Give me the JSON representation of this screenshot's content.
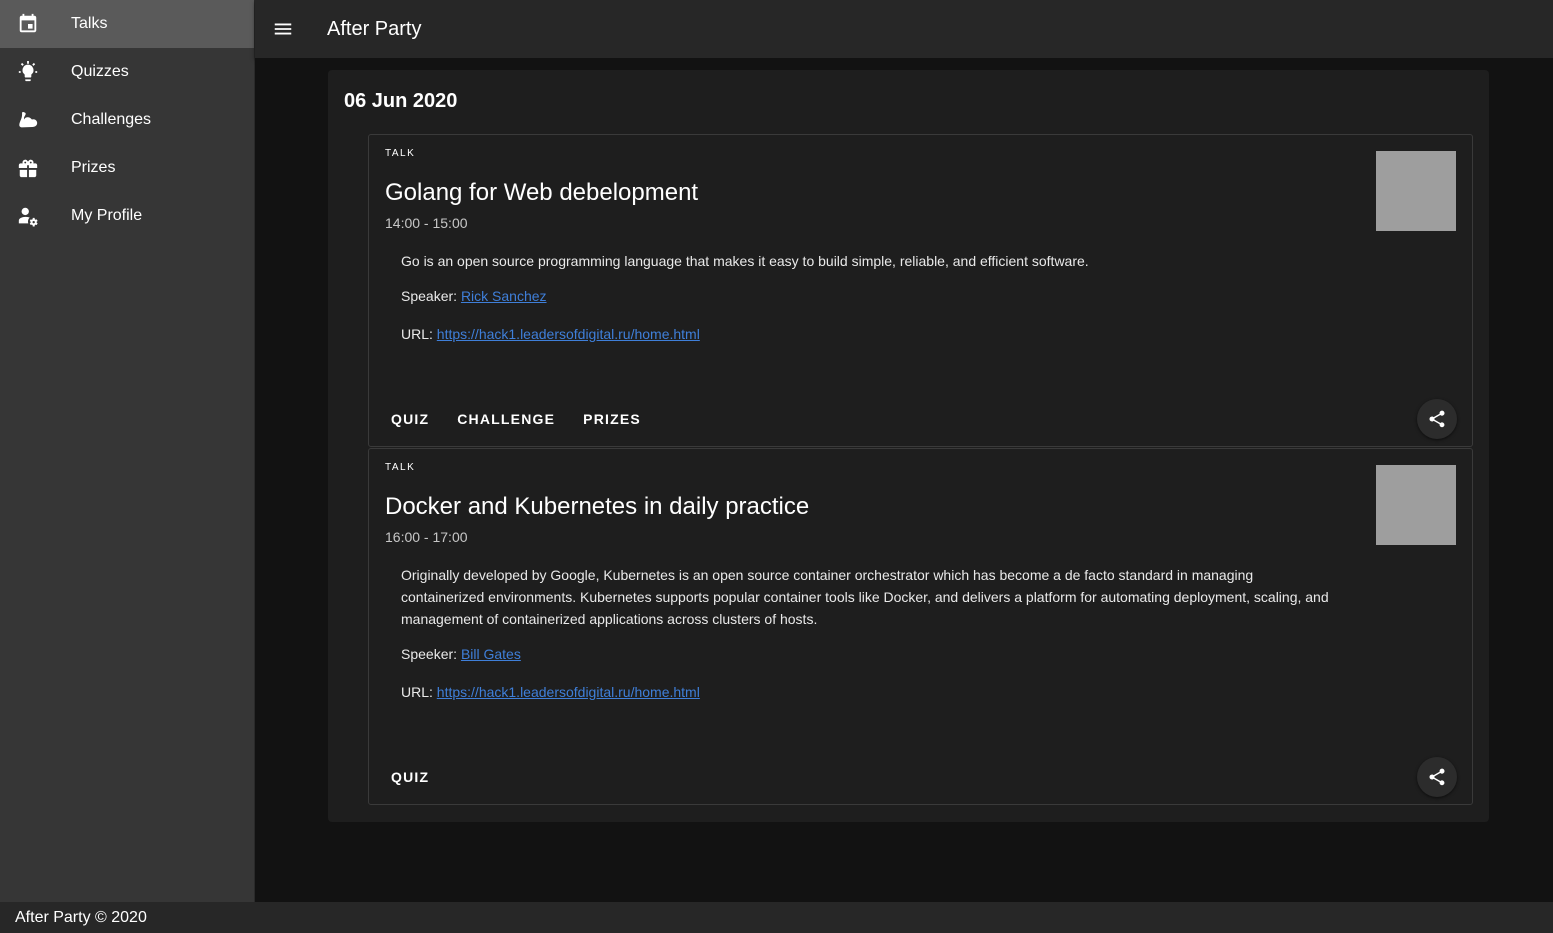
{
  "app": {
    "title": "After Party"
  },
  "sidebar": {
    "items": [
      {
        "label": "Talks",
        "icon": "calendar-icon",
        "active": true
      },
      {
        "label": "Quizzes",
        "icon": "lightbulb-icon",
        "active": false
      },
      {
        "label": "Challenges",
        "icon": "muscle-icon",
        "active": false
      },
      {
        "label": "Prizes",
        "icon": "gift-icon",
        "active": false
      },
      {
        "label": "My Profile",
        "icon": "user-settings-icon",
        "active": false
      }
    ]
  },
  "main": {
    "date": "06 Jun 2020",
    "talks": [
      {
        "overline": "TALK",
        "title": "Golang for Web debelopment",
        "time": "14:00 - 15:00",
        "description": "Go is an open source programming language that makes it easy to build simple, reliable, and efficient software.",
        "speaker_label": "Speaker:",
        "speaker": "Rick Sanchez",
        "url_label": "URL:",
        "url": "https://hack1.leadersofdigital.ru/home.html",
        "actions": [
          "QUIZ",
          "CHALLENGE",
          "PRIZES"
        ]
      },
      {
        "overline": "TALK",
        "title": "Docker and Kubernetes in daily practice",
        "time": "16:00 - 17:00",
        "description": "Originally developed by Google, Kubernetes is an open source container orchestrator which has become a de facto standard in managing containerized environments. Kubernetes supports popular container tools like Docker, and delivers a platform for automating deployment, scaling, and management of containerized applications across clusters of hosts.",
        "speaker_label": "Speeker:",
        "speaker": "Bill Gates",
        "url_label": "URL:",
        "url": "https://hack1.leadersofdigital.ru/home.html",
        "actions": [
          "QUIZ"
        ]
      }
    ]
  },
  "footer": {
    "text": "After Party © 2020"
  },
  "colors": {
    "sidebar_bg": "#363636",
    "active_item_bg": "#5a5a5a",
    "appbar_bg": "#272727",
    "main_bg": "#121212",
    "card_bg": "#1e1e1e",
    "link": "#3f7fd9",
    "thumbnail": "#9e9e9e"
  }
}
